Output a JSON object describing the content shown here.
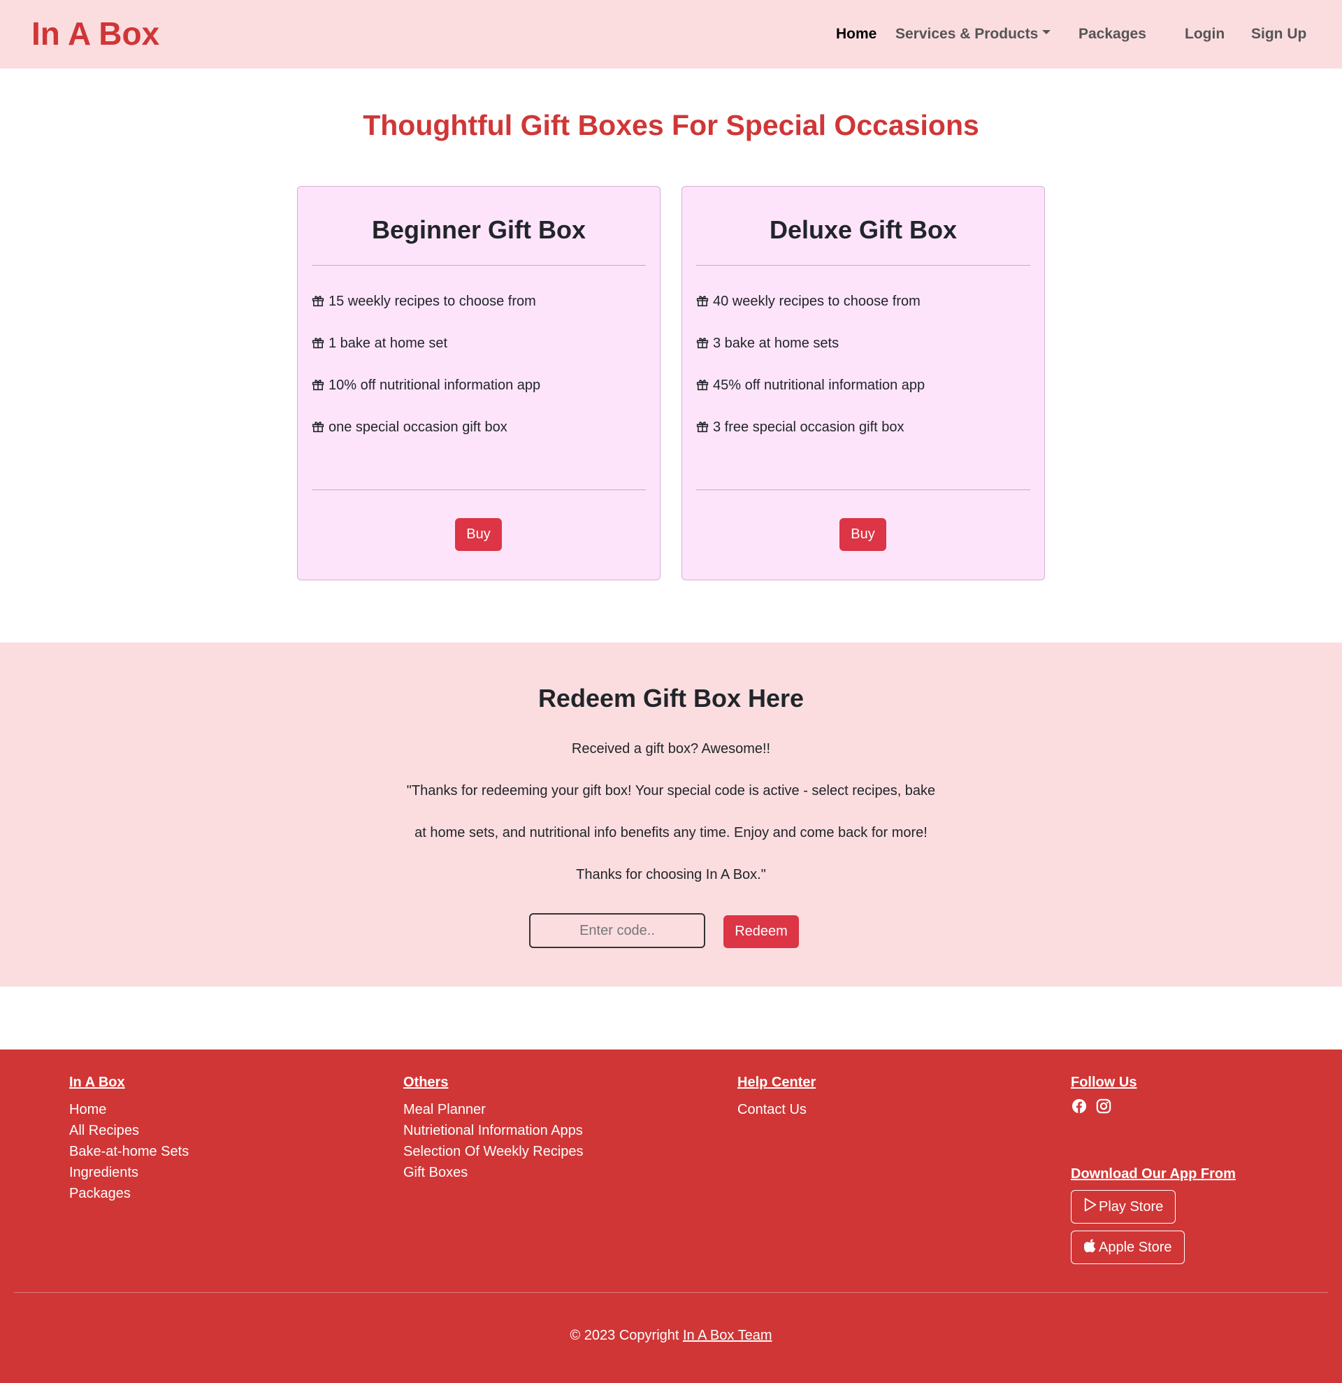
{
  "navbar": {
    "brand": "In A Box",
    "links": [
      "Home",
      "Services & Products",
      "Packages",
      "Login",
      "Sign Up"
    ]
  },
  "hero": {
    "title": "Thoughtful Gift Boxes For Special Occasions"
  },
  "cards": [
    {
      "title": "Beginner Gift Box",
      "features": [
        "15 weekly recipes to choose from",
        "1 bake at home set",
        "10% off nutritional information app",
        "one special occasion gift box"
      ],
      "button": "Buy"
    },
    {
      "title": "Deluxe Gift Box",
      "features": [
        "40 weekly recipes to choose from",
        "3 bake at home sets",
        "45% off nutritional information app",
        "3 free special occasion gift box"
      ],
      "button": "Buy"
    }
  ],
  "redeem": {
    "title": "Redeem Gift Box Here",
    "lines": [
      "Received a gift box? Awesome!!",
      "\"Thanks for redeeming your gift box! Your special code is active - select recipes, bake",
      "at home sets, and nutritional info benefits any time. Enjoy and come back for more!",
      "Thanks for choosing In A Box.\""
    ],
    "input": {
      "placeholder": "Enter code..",
      "value": ""
    },
    "button": "Redeem"
  },
  "footer": {
    "columns": [
      {
        "heading": "In A Box",
        "links": [
          "Home",
          "All Recipes",
          "Bake-at-home Sets",
          "Ingredients",
          "Packages"
        ]
      },
      {
        "heading": "Others",
        "links": [
          "Meal Planner",
          "Nutrietional Information Apps",
          "Selection Of Weekly Recipes",
          "Gift Boxes"
        ]
      },
      {
        "heading": "Help Center",
        "links": [
          "Contact Us"
        ]
      }
    ],
    "follow": {
      "heading": "Follow Us",
      "icons": [
        "facebook-icon",
        "instagram-icon"
      ]
    },
    "download": {
      "heading": "Download Our App From",
      "play_store": "Play Store",
      "apple_store": "Apple Store"
    },
    "copyright": {
      "prefix": "© 2023 Copyright",
      "link": "In A Box Team"
    }
  },
  "colors": {
    "brand_red": "#d03636",
    "button_red": "#dc3545",
    "nav_bg": "#fbdde0",
    "card_bg": "#fde4fb"
  }
}
